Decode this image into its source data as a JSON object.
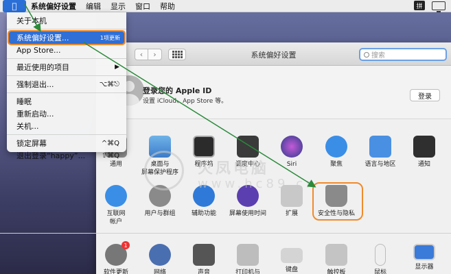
{
  "menubar": {
    "items": [
      "系统偏好设置",
      "编辑",
      "显示",
      "窗口",
      "帮助"
    ],
    "ime": "拼"
  },
  "apple_menu": {
    "items": [
      {
        "label": "关于本机"
      },
      {
        "label": "系统偏好设置...",
        "badge": "1项更新"
      },
      {
        "label": "App Store..."
      },
      {
        "label": "最近使用的项目"
      },
      {
        "label": "强制退出...",
        "shortcut": "⌥⌘⎋"
      },
      {
        "label": "睡眠"
      },
      {
        "label": "重新启动..."
      },
      {
        "label": "关机..."
      },
      {
        "label": "锁定屏幕",
        "shortcut": "^⌘Q"
      },
      {
        "label": "退出登录“happy”...",
        "shortcut": "⇧⌘Q"
      }
    ]
  },
  "window": {
    "title": "系统偏好设置",
    "search_placeholder": "搜索",
    "apple_id": {
      "title": "登录您的 Apple ID",
      "subtitle": "设置 iCloud、App Store 等。",
      "login_button": "登录"
    },
    "panes_row1": [
      {
        "label": "通用",
        "icon": "general-icon"
      },
      {
        "label": "桌面与\n屏幕保护程序",
        "icon": "desktop-icon"
      },
      {
        "label": "程序坞",
        "icon": "dock-icon"
      },
      {
        "label": "调度中心",
        "icon": "mission-control-icon"
      },
      {
        "label": "Siri",
        "icon": "siri-icon"
      },
      {
        "label": "聚焦",
        "icon": "spotlight-icon"
      },
      {
        "label": "语言与地区",
        "icon": "language-icon"
      },
      {
        "label": "通知",
        "icon": "notifications-icon"
      }
    ],
    "panes_row2": [
      {
        "label": "互联网\n帐户",
        "icon": "internet-accounts-icon"
      },
      {
        "label": "用户与群组",
        "icon": "users-icon"
      },
      {
        "label": "辅助功能",
        "icon": "accessibility-icon"
      },
      {
        "label": "屏幕使用时间",
        "icon": "screen-time-icon"
      },
      {
        "label": "扩展",
        "icon": "extensions-icon"
      },
      {
        "label": "安全性与隐私",
        "icon": "security-icon"
      }
    ],
    "panes_row3": [
      {
        "label": "软件更新",
        "icon": "software-update-icon",
        "badge": "1"
      },
      {
        "label": "网络",
        "icon": "network-icon"
      },
      {
        "label": "声音",
        "icon": "sound-icon"
      },
      {
        "label": "打印机与",
        "icon": "printer-icon"
      },
      {
        "label": "键盘",
        "icon": "keyboard-icon"
      },
      {
        "label": "触控板",
        "icon": "trackpad-icon"
      },
      {
        "label": "鼠标",
        "icon": "mouse-icon"
      },
      {
        "label": "显示器",
        "icon": "display-icon"
      }
    ]
  },
  "watermark": {
    "text": "火凤电脑",
    "url": "www.hc89.cn"
  },
  "colors": {
    "accent": "#2f6fd6",
    "highlight": "#f08a2a",
    "arrow": "#2a8a3a"
  }
}
